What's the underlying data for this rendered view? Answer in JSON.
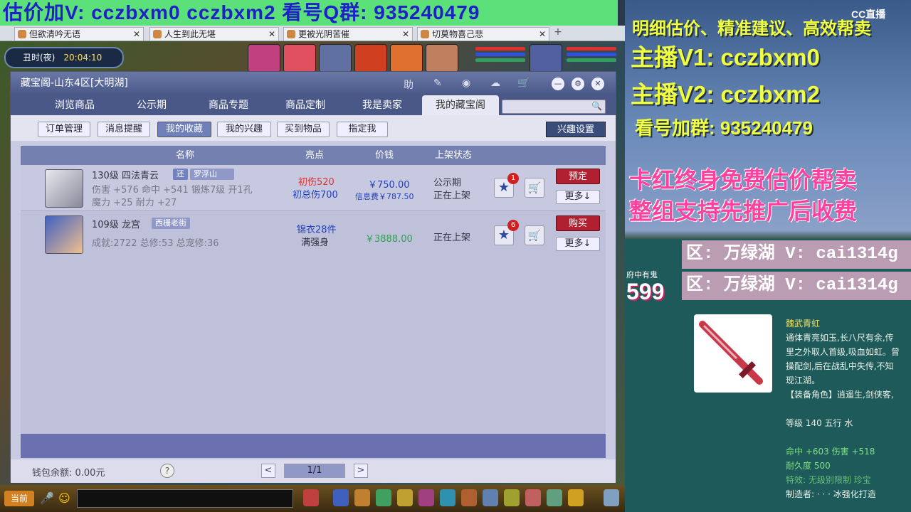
{
  "stream_banner": {
    "text": "估价加V:  cczbxm0   cczbxm2   看号Q群: 935240479"
  },
  "browser_tabs": [
    "但欲清吟无语",
    "人生到此无堪",
    "更被光阴苦催",
    "切莫物喜己悲"
  ],
  "game_clock": {
    "period": "丑时(夜)",
    "time": "20:04:10"
  },
  "window": {
    "title": "藏宝阁-山东4区[大明湖]",
    "help": "助"
  },
  "nav_tabs": [
    "浏览商品",
    "公示期",
    "商品专题",
    "商品定制",
    "我是卖家",
    "我的藏宝阁"
  ],
  "sub_tabs": [
    "订单管理",
    "消息提醒",
    "我的收藏",
    "我的兴趣",
    "买到物品",
    "指定我"
  ],
  "interest_settings": "兴趣设置",
  "table_headers": [
    "名称",
    "亮点",
    "价钱",
    "上架状态"
  ],
  "items": [
    {
      "level_name": "130级  四法青云",
      "tag1": "还",
      "tag2": "罗浮山",
      "line2": "伤害 +576 命中 +541 锻炼7级 开1孔",
      "line3": "魔力 +25 耐力 +27",
      "highlight1": "初伤520",
      "highlight2": "初总伤700",
      "price": "￥750.00",
      "info_fee": "信息费￥787.50",
      "status1": "公示期",
      "status2": "正在上架",
      "fav_count": "1",
      "action": "预定",
      "more": "更多↓"
    },
    {
      "level_name": "109级  龙宫",
      "tag1": "西栅老街",
      "line2": "成就:2722 总修:53 总宠修:36",
      "highlight1": "锦衣28件",
      "highlight2": "满强身",
      "price": "￥3888.00",
      "status2": "正在上架",
      "fav_count": "6",
      "action": "购买",
      "more": "更多↓"
    }
  ],
  "footer": {
    "wallet": "钱包余额:  0.00元",
    "help": "?",
    "page": "1/1",
    "prev": "<",
    "next": ">"
  },
  "chat": {
    "channel": "当前"
  },
  "right": {
    "line1": "明细估价、精准建议、高效帮卖",
    "line2": "主播V1:  cczbxm0",
    "line3": "主播V2:  cczbxm2",
    "line4": "看号加群: 935240479",
    "line5": "卡红终身免费估价帮卖",
    "line6": "整组支持先推广后收费",
    "watermark": "CC直播",
    "region1": "区: 万绿湖 V: cai1314g",
    "region2": "区: 万绿湖 V: cai1314g",
    "small_label": "府中有鬼",
    "big_num": "599"
  },
  "item_detail": {
    "name": "魏武青虹",
    "desc1": "通体青亮如玉,长八尺有余,传",
    "desc2": "里之外取人首级,吸血如虹。曾",
    "desc3": "操配剑,后在战乱中失传,不知",
    "desc4": "现江湖。",
    "desc5": "【装备角色】逍遥生,剑侠客,",
    "level": "等级 140 五行 水",
    "stats1": "命中 +603 伤害 +518",
    "stats2": "耐久度 500",
    "special": "特效: 无级别限制 珍宝",
    "maker": "制造者: · · · 冰强化打造"
  }
}
